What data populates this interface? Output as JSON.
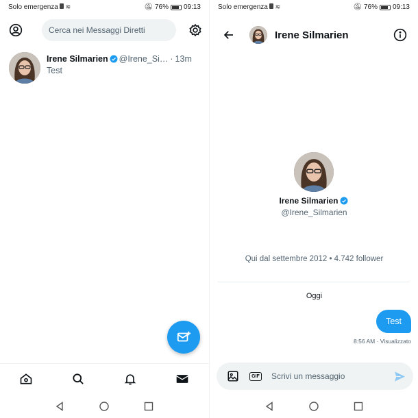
{
  "status_bar": {
    "carrier": "Solo emergenza",
    "battery": "76%",
    "time": "09:13"
  },
  "left": {
    "search": {
      "placeholder": "Cerca nei Messaggi Diretti"
    },
    "conversation": {
      "name": "Irene Silmarien",
      "handle": "@Irene_Si…",
      "separator": "·",
      "time": "13m",
      "last_message": "Test"
    },
    "nav": [
      "home-icon",
      "search-icon",
      "notifications-bell-icon",
      "messages-envelope-icon"
    ],
    "fab_icon": "new-message-icon"
  },
  "right": {
    "header": {
      "title": "Irene Silmarien",
      "back_icon": "arrow-left-icon",
      "info_icon": "info-icon"
    },
    "profile": {
      "name": "Irene Silmarien",
      "handle": "@Irene_Silmarien",
      "meta": "Qui dal settembre 2012 • 4.742 follower"
    },
    "day_label": "Oggi",
    "message": {
      "text": "Test",
      "time": "8:56 AM",
      "separator": "·",
      "status": "Visualizzato"
    },
    "composer": {
      "placeholder": "Scrivi un messaggio",
      "gif_label": "GIF"
    }
  },
  "colors": {
    "accent": "#1d9bf0",
    "muted": "#536471",
    "input_bg": "#eff3f4"
  }
}
